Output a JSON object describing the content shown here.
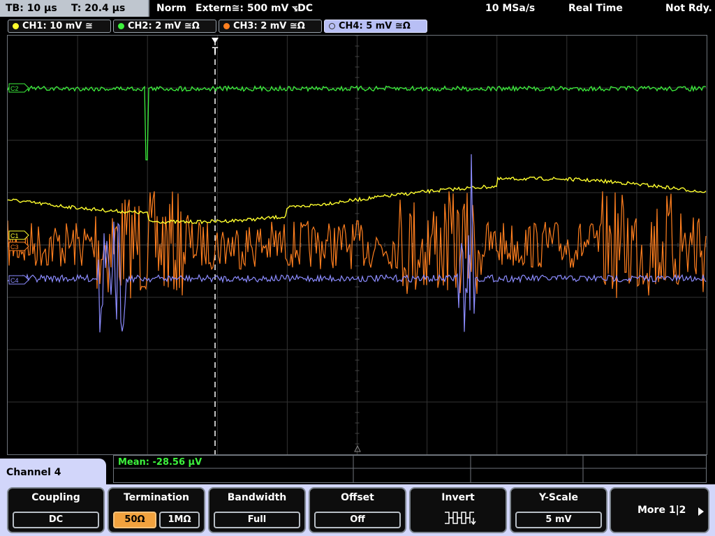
{
  "topbar": {
    "timebase": "TB: 10 µs",
    "trigger_time": "T: 20.4 µs",
    "mode": "Norm",
    "trigger_source": "Extern≅: 500 mV ⦪DC",
    "sample_rate": "10 MSa/s",
    "acquisition": "Real Time",
    "status": "Not Rdy."
  },
  "channels": [
    {
      "label": "CH1: 10 mV ≅",
      "color": "#ffff2e",
      "marker": "C1",
      "active": false
    },
    {
      "label": "CH2: 2 mV ≅Ω",
      "color": "#3df23d",
      "marker": "C2",
      "active": false
    },
    {
      "label": "CH3: 2 mV ≅Ω",
      "color": "#ff7f1f",
      "marker": "C3",
      "active": false
    },
    {
      "label": "CH4: 5 mV ≅Ω",
      "color": "#8c8cff",
      "marker": "C4",
      "active": true
    }
  ],
  "trigger_marker": "T",
  "measurement": {
    "text": "Mean: -28.56 µV"
  },
  "menu": {
    "title": "Channel 4",
    "coupling": {
      "title": "Coupling",
      "value": "DC"
    },
    "termination": {
      "title": "Termination",
      "option_a": "50Ω",
      "option_b": "1MΩ",
      "selected": "50Ω"
    },
    "bandwidth": {
      "title": "Bandwidth",
      "value": "Full"
    },
    "offset": {
      "title": "Offset",
      "value": "Off"
    },
    "invert": {
      "title": "Invert",
      "icon": "invert-waveform-icon"
    },
    "yscale": {
      "title": "Y-Scale",
      "value": "5 mV"
    },
    "more": {
      "label": "More 1|2",
      "icon": "right-arrow-icon"
    }
  },
  "colors": {
    "grid": "#3a3a3a",
    "accent": "#d2d6fa",
    "selected": "#f2a23e"
  }
}
